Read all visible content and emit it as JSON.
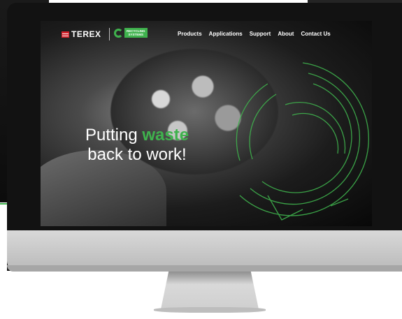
{
  "brand": {
    "name": "TEREX",
    "sub_logo_line1": "RECYCLING",
    "sub_logo_line2": "SYSTEMS"
  },
  "nav": {
    "items": [
      {
        "label": "Products"
      },
      {
        "label": "Applications"
      },
      {
        "label": "Support"
      },
      {
        "label": "About"
      },
      {
        "label": "Contact Us"
      }
    ]
  },
  "hero": {
    "line1_prefix": "Putting ",
    "line1_accent": "waste",
    "line2": "back to work!"
  },
  "colors": {
    "accent": "#3fb24d",
    "terex_red": "#d3202a"
  }
}
